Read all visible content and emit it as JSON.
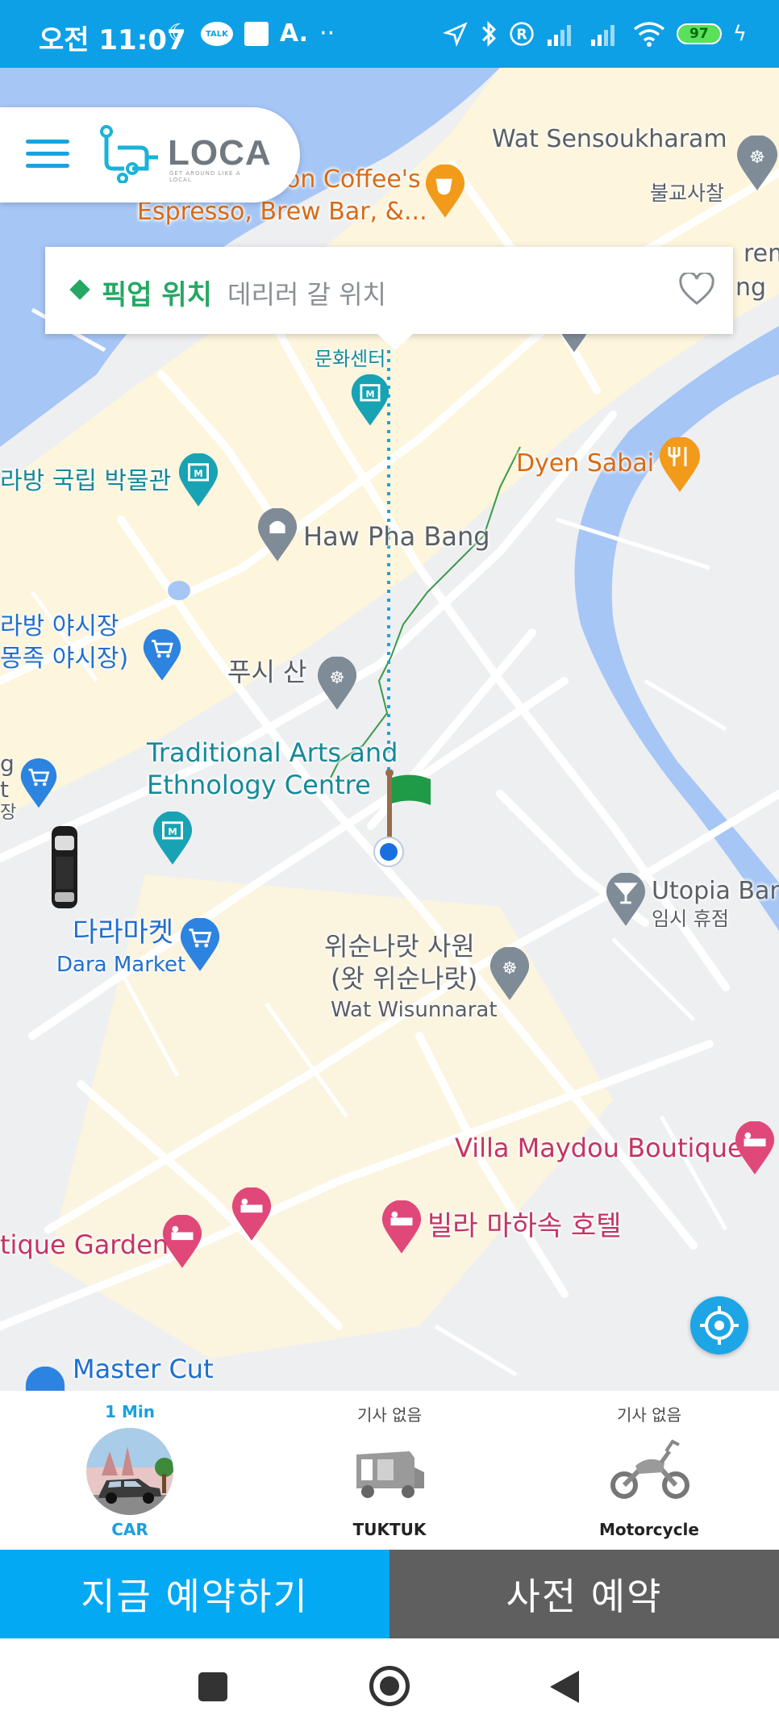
{
  "status_bar": {
    "time": "오전 11:07",
    "left_icons": [
      "moon-icon",
      "kakaotalk-icon",
      "square-icon",
      "a-icon",
      "more-dots-icon"
    ],
    "right_icons": [
      "location-arrow-icon",
      "bluetooth-icon",
      "registered-icon",
      "signal-icon",
      "signal-icon",
      "wifi-icon",
      "battery-icon",
      "charging-icon"
    ],
    "a_label": "A.",
    "dots": "··",
    "battery": "97",
    "talk": "TALK"
  },
  "header": {
    "logo_text": "LOCA",
    "logo_tagline": "GET AROUND LIKE A LOCAL"
  },
  "pickup": {
    "label": "픽업 위치",
    "placeholder": "데리러 갈 위치"
  },
  "map": {
    "labels": {
      "wat_sensoukharam": "Wat Sensoukharam",
      "buddhist_temple": "불교사찰",
      "coffee_line1": "on Coffee's",
      "coffee_line2": "Espresso, Brew Bar, &...",
      "culture_center": "문화센터",
      "national_museum": "라방 국립 박물관",
      "dyen_sabai": "Dyen Sabai",
      "haw_pha_bang": "Haw Pha Bang",
      "night_market_1": "라방 야시장",
      "night_market_2": "몽족 야시장)",
      "phousi": "푸시 산",
      "tae_line1": "Traditional Arts and",
      "tae_line2": "Ethnology Centre",
      "left_g": "g",
      "left_t": "t",
      "left_jang": "장",
      "dara_kr": "다라마켓",
      "dara_en": "Dara Market",
      "utopia_en": "Utopia Bar",
      "utopia_status": "임시 휴점",
      "wisun_1": "위순나랏 사원",
      "wisun_2": "(왓 위순나랏)",
      "wisun_3": "Wat Wisunnarat",
      "villa_maydou": "Villa Maydou Boutique",
      "villa_mahasok": "빌라 마하속 호텔",
      "boutique_garden": "tique Garden",
      "master_cut": "Master Cut",
      "edge_ng": "ng",
      "edge_reme": "reme"
    }
  },
  "vehicles": [
    {
      "status": "1 Min",
      "name": "CAR",
      "icon": "car-icon",
      "active": true
    },
    {
      "status": "기사 없음",
      "name": "TUKTUK",
      "icon": "tuktuk-icon",
      "active": false
    },
    {
      "status": "기사 없음",
      "name": "Motorcycle",
      "icon": "motorcycle-icon",
      "active": false
    }
  ],
  "actions": {
    "book_now": "지금 예약하기",
    "book_advance": "사전 예약"
  },
  "colors": {
    "status_bar": "#0ea0e6",
    "accent": "#04a9f4",
    "secondary": "#5f5f5f",
    "pickup_green": "#24a863",
    "water": "#a6c6f6",
    "road_area": "#fdf5dc"
  }
}
